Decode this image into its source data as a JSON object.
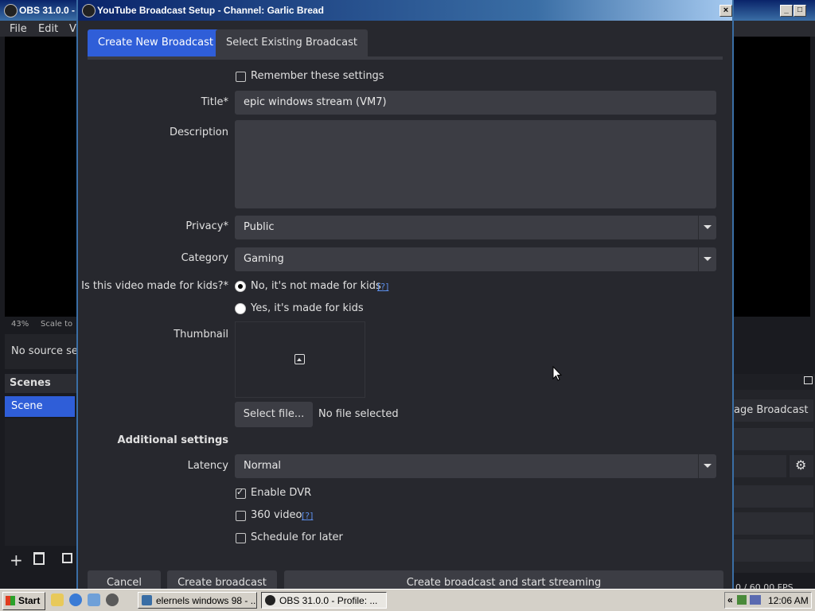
{
  "obs": {
    "title": "OBS 31.0.0 -",
    "menu": [
      "File",
      "Edit",
      "V"
    ],
    "zoom": "43%",
    "scale_label": "Scale to",
    "no_source": "No source sel",
    "scenes_header": "Scenes",
    "scene_item": "Scene",
    "manage_broadcast": "age Broadcast",
    "fps": "0 / 60.00 FPS"
  },
  "dialog": {
    "title": "YouTube Broadcast Setup - Channel: Garlic Bread",
    "close": "×",
    "tabs": [
      "Create New Broadcast",
      "Select Existing Broadcast"
    ],
    "remember": "Remember these settings",
    "title_label": "Title*",
    "title_value": "epic windows stream (VM7)",
    "description_label": "Description",
    "description_value": "",
    "privacy_label": "Privacy*",
    "privacy_value": "Public",
    "category_label": "Category",
    "category_value": "Gaming",
    "kids_label": "Is this video made for kids?*",
    "kids_no": "No, it's not made for kids",
    "kids_yes": "Yes, it's made for kids",
    "help_link": "[?]",
    "thumbnail_label": "Thumbnail",
    "select_file": "Select file...",
    "no_file": "No file selected",
    "additional_settings": "Additional settings",
    "latency_label": "Latency",
    "latency_value": "Normal",
    "enable_dvr": "Enable DVR",
    "video_360": "360 video",
    "schedule_later": "Schedule for later",
    "cancel": "Cancel",
    "create_broadcast": "Create broadcast",
    "create_and_start": "Create broadcast and start streaming",
    "state": {
      "remember": false,
      "kids_no": true,
      "dvr": true,
      "v360": false,
      "schedule": false
    }
  },
  "taskbar": {
    "start": "Start",
    "tasks": [
      "elernels windows 98 - ...",
      "OBS 31.0.0 - Profile: ..."
    ],
    "tray_arrow": "«",
    "clock": "12:06 AM"
  },
  "colors": {
    "accent": "#2f5ed8",
    "dialog_bg": "#27282e",
    "field_bg": "#3c3d44",
    "taskbar": "#d4d0c8"
  }
}
